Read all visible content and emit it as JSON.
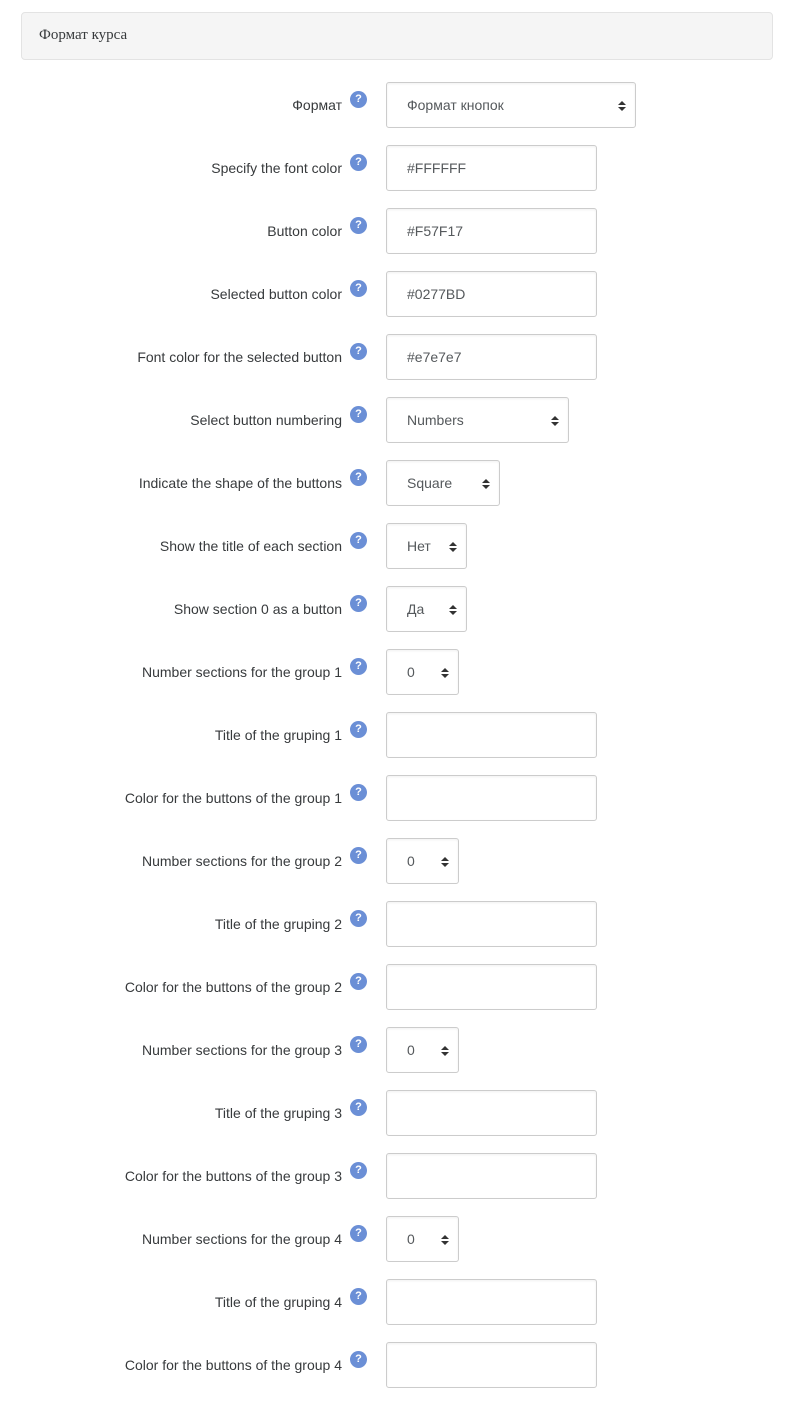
{
  "section": {
    "title": "Формат курса"
  },
  "help_icon": {
    "glyph": "?",
    "icon": "question-circle-icon",
    "color": "#6b8fd6"
  },
  "fields": [
    {
      "label": "Формат",
      "type": "select",
      "value": "Формат кнопок"
    },
    {
      "label": "Specify the font color",
      "type": "text",
      "value": "#FFFFFF"
    },
    {
      "label": "Button color",
      "type": "text",
      "value": "#F57F17"
    },
    {
      "label": "Selected button color",
      "type": "text",
      "value": "#0277BD"
    },
    {
      "label": "Font color for the selected button",
      "type": "text",
      "value": "#e7e7e7"
    },
    {
      "label": "Select button numbering",
      "type": "select",
      "value": "Numbers"
    },
    {
      "label": "Indicate the shape of the buttons",
      "type": "select",
      "value": "Square"
    },
    {
      "label": "Show the title of each section",
      "type": "select",
      "value": "Нет"
    },
    {
      "label": "Show section 0 as a button",
      "type": "select",
      "value": "Да"
    },
    {
      "label": "Number sections for the group 1",
      "type": "select",
      "value": "0"
    },
    {
      "label": "Title of the gruping 1",
      "type": "text",
      "value": ""
    },
    {
      "label": "Color for the buttons of the group 1",
      "type": "text",
      "value": ""
    },
    {
      "label": "Number sections for the group 2",
      "type": "select",
      "value": "0"
    },
    {
      "label": "Title of the gruping 2",
      "type": "text",
      "value": ""
    },
    {
      "label": "Color for the buttons of the group 2",
      "type": "text",
      "value": ""
    },
    {
      "label": "Number sections for the group 3",
      "type": "select",
      "value": "0"
    },
    {
      "label": "Title of the gruping 3",
      "type": "text",
      "value": ""
    },
    {
      "label": "Color for the buttons of the group 3",
      "type": "text",
      "value": ""
    },
    {
      "label": "Number sections for the group 4",
      "type": "select",
      "value": "0"
    },
    {
      "label": "Title of the gruping 4",
      "type": "text",
      "value": ""
    },
    {
      "label": "Color for the buttons of the group 4",
      "type": "text",
      "value": ""
    }
  ]
}
